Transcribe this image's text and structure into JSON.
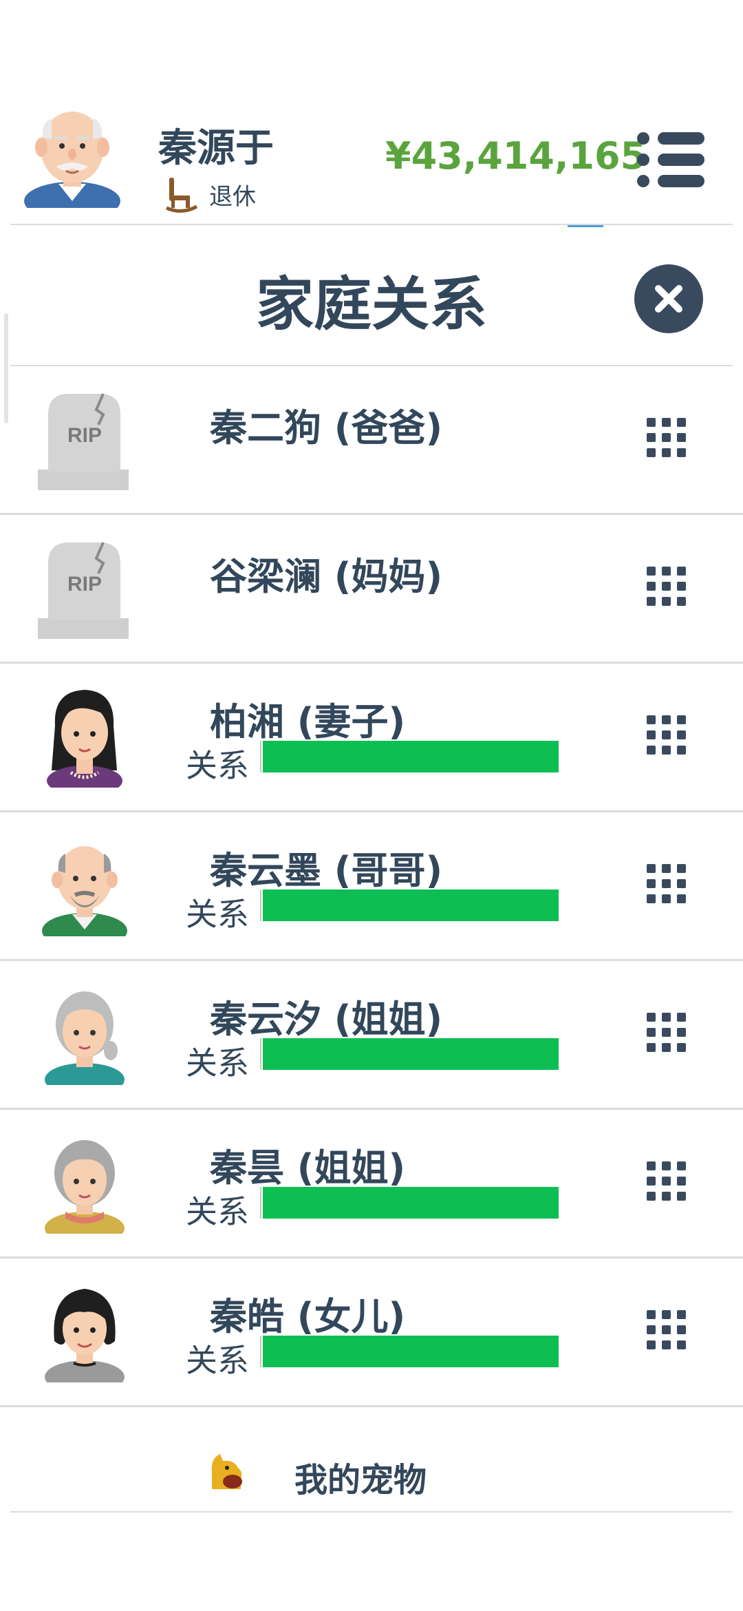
{
  "header": {
    "player_name": "秦源于",
    "status": "退休",
    "money": "¥43,414,165"
  },
  "panel": {
    "title": "家庭关系"
  },
  "relation_label": "关系",
  "members": [
    {
      "name": "秦二狗 (爸爸)",
      "deceased": true,
      "avatar": "rip-tombstone-icon"
    },
    {
      "name": "谷梁澜 (妈妈)",
      "deceased": true,
      "avatar": "rip-tombstone-icon"
    },
    {
      "name": "柏湘 (妻子)",
      "deceased": false,
      "relationship": 1.0,
      "avatar": "young-woman-avatar"
    },
    {
      "name": "秦云墨 (哥哥)",
      "deceased": false,
      "relationship": 1.0,
      "avatar": "old-man-avatar"
    },
    {
      "name": "秦云汐 (姐姐)",
      "deceased": false,
      "relationship": 1.0,
      "avatar": "old-woman-avatar"
    },
    {
      "name": "秦昙 (姐姐)",
      "deceased": false,
      "relationship": 1.0,
      "avatar": "old-woman-avatar"
    },
    {
      "name": "秦皓 (女儿)",
      "deceased": false,
      "relationship": 1.0,
      "avatar": "woman-avatar"
    }
  ],
  "pets": {
    "label": "我的宠物",
    "icon": "dog-icon"
  },
  "colors": {
    "money": "#5aa43e",
    "relationship_bar": "#0dbf52",
    "text": "#33475b",
    "dark_button": "#3a4a5e"
  }
}
